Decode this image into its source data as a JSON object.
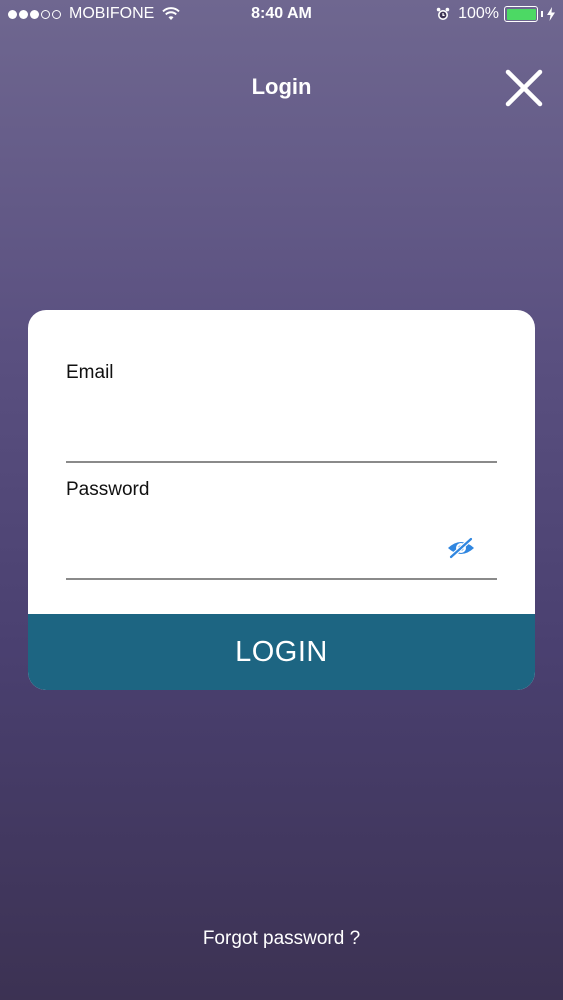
{
  "status_bar": {
    "carrier": "MOBIFONE",
    "signal_bars": 3,
    "signal_total": 5,
    "time": "8:40 AM",
    "battery_percent": "100%"
  },
  "header": {
    "title": "Login",
    "close_icon": "close-icon"
  },
  "form": {
    "email_label": "Email",
    "email_value": "",
    "password_label": "Password",
    "password_value": "",
    "password_toggle_icon": "eye-slash-icon",
    "login_label": "LOGIN"
  },
  "footer": {
    "forgot_label": "Forgot password ?"
  },
  "colors": {
    "login_button": "#1d6582",
    "eye_icon": "#2f86e0",
    "battery_fill": "#4cd964"
  }
}
